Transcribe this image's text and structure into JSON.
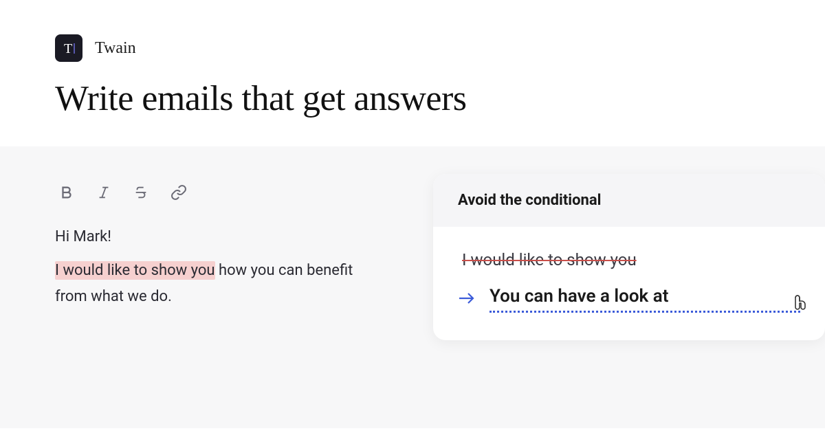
{
  "brand": {
    "name": "Twain"
  },
  "tagline": "Write emails that get answers",
  "editor": {
    "greeting": "Hi Mark!",
    "line_pre_highlight": "",
    "highlighted": "I would like to show you",
    "line_post_highlight": " how you can benefit from what we do."
  },
  "suggestion": {
    "title": "Avoid the conditional",
    "struck": "I would like to show you",
    "replacement": "You can have a look at"
  }
}
